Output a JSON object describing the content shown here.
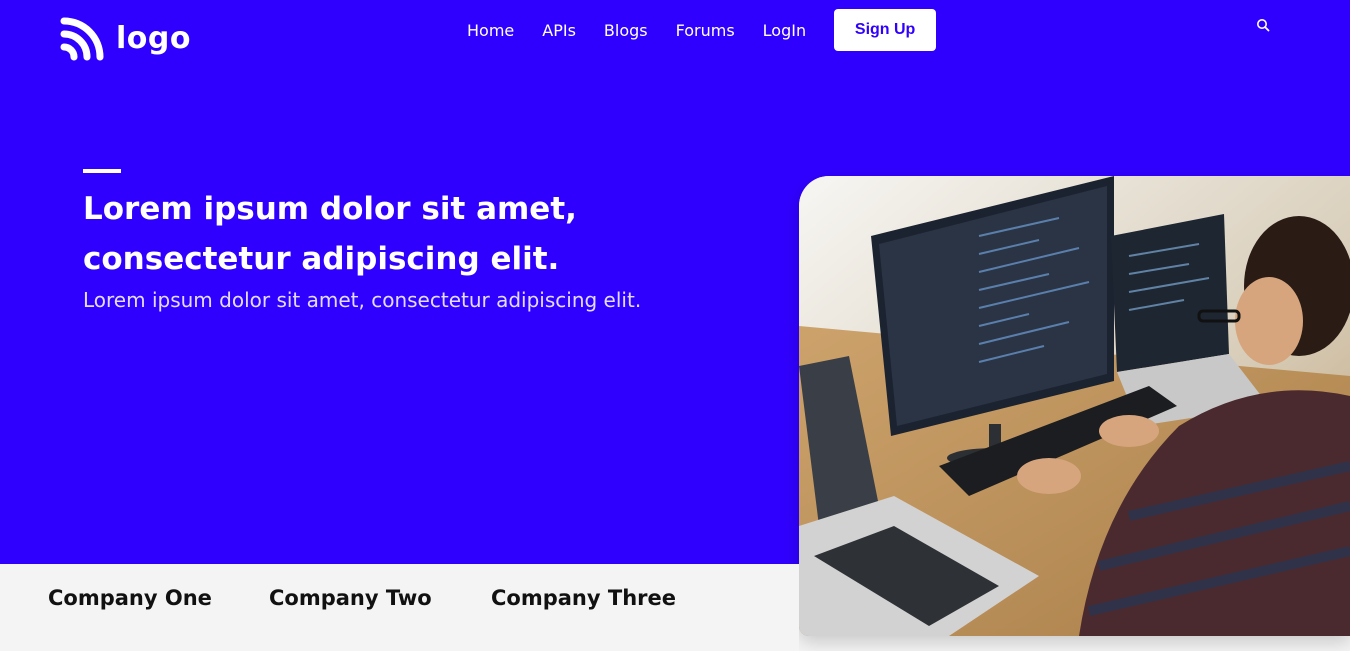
{
  "brand": {
    "logo_text": "logo"
  },
  "nav": {
    "links": [
      "Home",
      "APIs",
      "Blogs",
      "Forums",
      "LogIn"
    ],
    "signup_label": "Sign Up"
  },
  "hero": {
    "headline_line1": "Lorem ipsum dolor sit amet,",
    "headline_line2": "consectetur adipiscing elit.",
    "subheadline": "Lorem ipsum dolor sit amet, consectetur adipiscing elit."
  },
  "companies": [
    "Company One",
    "Company Two",
    "Company Three"
  ],
  "colors": {
    "primary": "#3000ff",
    "white": "#ffffff",
    "band": "#f4f4f4",
    "text_dark": "#111111"
  },
  "icons": {
    "logo": "rss-arcs-icon",
    "search": "search-icon"
  }
}
